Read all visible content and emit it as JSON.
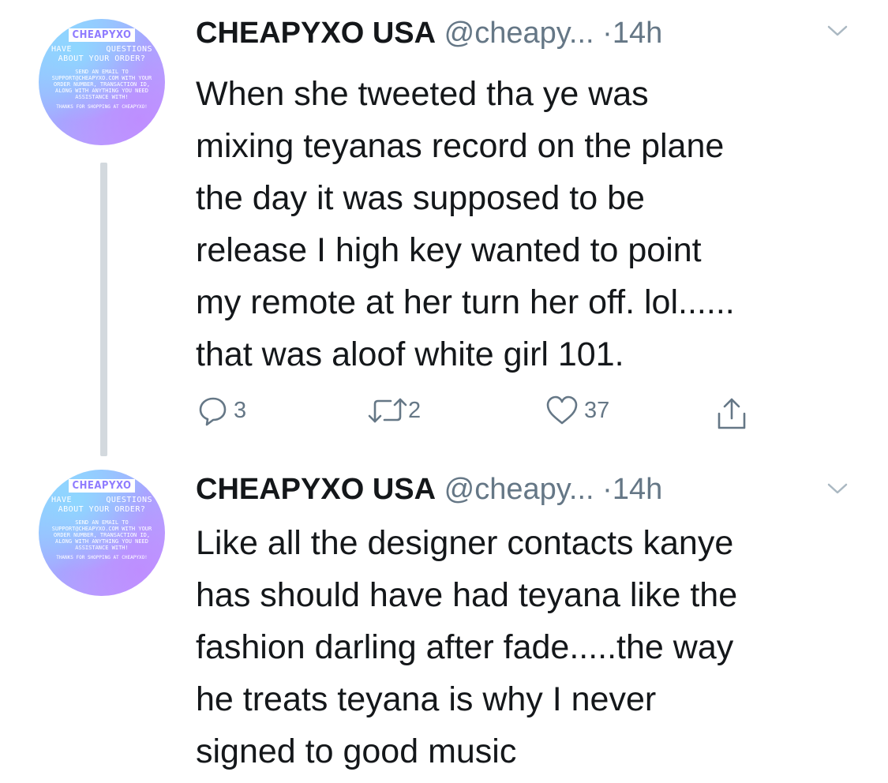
{
  "tweets": [
    {
      "avatar": {
        "brand": "CHEAPYXO",
        "line1_a": "HAVE",
        "line1_b": "QUESTIONS",
        "line2": "ABOUT YOUR ORDER?",
        "body": "SEND AN EMAIL TO SUPPORT@CHEAPYXO.COM WITH YOUR ORDER NUMBER, TRANSACTION ID, ALONG WITH ANYTHING YOU NEED ASSISTANCE WITH!",
        "thanks": "THANKS FOR SHOPPING AT CHEAPYXO!"
      },
      "name": "CHEAPYXO USA",
      "handle": "@cheapy...",
      "dot": "·",
      "time": "14h",
      "text": "When she tweeted tha ye was\nmixing teyanas record on the plane\nthe day it was supposed to be\nrelease I high key wanted to point\nmy remote at her turn her off. lol......\nthat was aloof white girl 101.",
      "actions": {
        "reply_count": "3",
        "retweet_count": "2",
        "like_count": "37"
      }
    },
    {
      "avatar": {
        "brand": "CHEAPYXO",
        "line1_a": "HAVE",
        "line1_b": "QUESTIONS",
        "line2": "ABOUT YOUR ORDER?",
        "body": "SEND AN EMAIL TO SUPPORT@CHEAPYXO.COM WITH YOUR ORDER NUMBER, TRANSACTION ID, ALONG WITH ANYTHING YOU NEED ASSISTANCE WITH!",
        "thanks": "THANKS FOR SHOPPING AT CHEAPYXO!"
      },
      "name": "CHEAPYXO USA",
      "handle": "@cheapy...",
      "dot": "·",
      "time": "14h",
      "text": "Like all the designer contacts kanye\nhas should have had teyana like the\nfashion darling after fade.....the way\nhe treats teyana is why I never\nsigned to good music"
    }
  ],
  "colors": {
    "text": "#14171a",
    "secondary": "#657786",
    "thread_line": "#d3d9de"
  }
}
